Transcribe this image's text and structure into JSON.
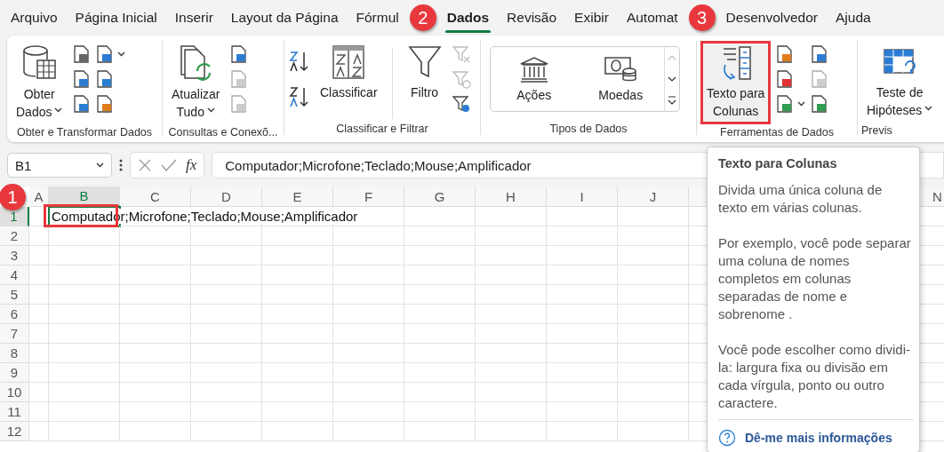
{
  "menu_tabs": [
    {
      "label": "Arquivo",
      "selected": false
    },
    {
      "label": "Página Inicial",
      "selected": false
    },
    {
      "label": "Inserir",
      "selected": false
    },
    {
      "label": "Layout da Página",
      "selected": false
    },
    {
      "label": "Fórmul",
      "selected": false
    },
    {
      "label": "Dados",
      "selected": true,
      "callout": "2"
    },
    {
      "label": "Revisão",
      "selected": false
    },
    {
      "label": "Exibir",
      "selected": false
    },
    {
      "label": "Automat",
      "selected": false
    },
    {
      "label": "Desenvolvedor",
      "selected": false,
      "callout": "3"
    },
    {
      "label": "Ajuda",
      "selected": false
    }
  ],
  "ribbon": [
    {
      "kind": "get_data",
      "title": "Obter e Transformar Dados",
      "buttons": [
        {
          "lines": [
            "Obter",
            "Dados"
          ],
          "dropdown": true,
          "highlighted": false
        }
      ]
    },
    {
      "kind": "queries",
      "title": "Consultas e Conexõ...",
      "buttons": [
        {
          "lines": [
            "Atualizar",
            "Tudo"
          ],
          "dropdown": true,
          "highlighted": false
        }
      ]
    },
    {
      "kind": "sort_filter",
      "title": "Classificar e Filtrar",
      "buttons": [
        {
          "lines": [
            "Classificar"
          ],
          "dropdown": false,
          "highlighted": false
        },
        {
          "lines": [
            "Filtro"
          ],
          "dropdown": false,
          "highlighted": false
        }
      ]
    },
    {
      "kind": "data_types",
      "title": "Tipos de Dados",
      "gallery": [
        "Ações",
        "Moedas"
      ]
    },
    {
      "kind": "data_tools",
      "title": "Ferramentas de Dados",
      "buttons": [
        {
          "lines": [
            "Texto para",
            "Colunas"
          ],
          "dropdown": false,
          "highlighted": true
        }
      ]
    },
    {
      "kind": "forecast",
      "title": "Previs",
      "buttons": [
        {
          "lines": [
            "Teste de",
            "Hipóteses"
          ],
          "dropdown": true,
          "highlighted": false
        }
      ]
    }
  ],
  "formula_bar": {
    "name_box": "B1",
    "function_label": "fx",
    "formula": "Computador;Microfone;Teclado;Mouse;Amplificador"
  },
  "sheet": {
    "columns": [
      {
        "label": "A",
        "selected": false
      },
      {
        "label": "B",
        "selected": true
      },
      {
        "label": "C",
        "selected": false
      },
      {
        "label": "D",
        "selected": false
      },
      {
        "label": "E",
        "selected": false
      },
      {
        "label": "F",
        "selected": false
      },
      {
        "label": "G",
        "selected": false
      },
      {
        "label": "H",
        "selected": false
      },
      {
        "label": "I",
        "selected": false
      },
      {
        "label": "J",
        "selected": false
      },
      {
        "label": "N",
        "selected": false
      }
    ],
    "rows": [
      {
        "label": "1",
        "selected": true,
        "content": "Computador;Microfone;Teclado;Mouse;Amplificador",
        "highlighted": true,
        "callout": "1"
      },
      {
        "label": "2",
        "selected": false
      },
      {
        "label": "3",
        "selected": false
      },
      {
        "label": "4",
        "selected": false
      },
      {
        "label": "5",
        "selected": false
      },
      {
        "label": "6",
        "selected": false
      },
      {
        "label": "7",
        "selected": false
      },
      {
        "label": "8",
        "selected": false
      },
      {
        "label": "9",
        "selected": false
      },
      {
        "label": "10",
        "selected": false
      },
      {
        "label": "11",
        "selected": false
      },
      {
        "label": "12",
        "selected": false
      }
    ]
  },
  "tooltip": {
    "title": "Texto para Colunas",
    "paragraphs": [
      "Divida uma única coluna de texto em várias colunas.",
      "Por exemplo, você pode separar uma coluna de nomes completos em colunas separadas de nome e sobrenome .",
      "Você pode escolher como dividi-la: largura fixa ou divisão em cada vírgula, ponto ou outro caractere."
    ],
    "link": "Dê-me mais informações"
  }
}
